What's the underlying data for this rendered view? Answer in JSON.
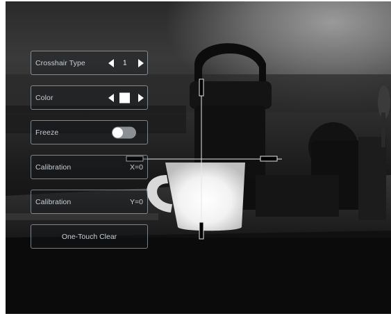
{
  "menu": {
    "crosshair_type": {
      "label": "Crosshair Type",
      "value": "1"
    },
    "color": {
      "label": "Color",
      "swatch_color": "#ffffff"
    },
    "freeze": {
      "label": "Freeze",
      "enabled": false
    },
    "calibration_x": {
      "label": "Calibration",
      "value": "X=0"
    },
    "calibration_y": {
      "label": "Calibration",
      "value": "Y=0"
    },
    "one_touch_clear": {
      "label": "One-Touch Clear"
    }
  },
  "colors": {
    "panel_border": "#d2dce6",
    "text": "#c8d0d8",
    "reticle": "#e6e6e6",
    "toggle_off": "#8c8f94"
  },
  "icons": [
    "chevron-left-icon",
    "chevron-right-icon"
  ]
}
